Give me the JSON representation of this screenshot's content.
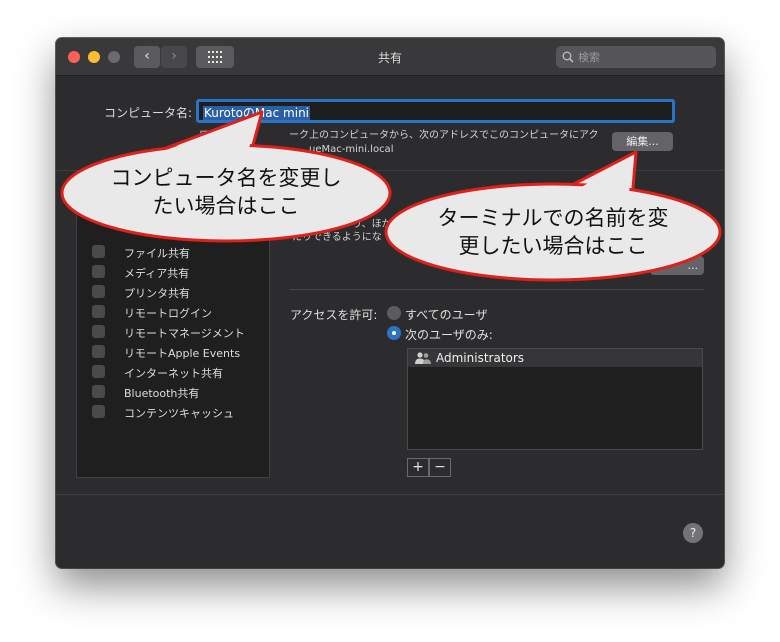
{
  "window": {
    "title": "共有",
    "search_placeholder": "検索"
  },
  "computer_name": {
    "label": "コンピュータ名:",
    "value_selected": "KurotoのMac mini",
    "edit_button": "編集...",
    "description_line1": "ローカル　　　　　ーク上のコンピュータから、次のアドレスでこのコンピュータにアク",
    "description_line2": "　　　　　　　　　　　ueMac-mini.local"
  },
  "services": {
    "items": [
      {
        "label": "ファイル共有"
      },
      {
        "label": "メディア共有"
      },
      {
        "label": "プリンタ共有"
      },
      {
        "label": "リモートログイン"
      },
      {
        "label": "リモートマネージメント"
      },
      {
        "label": "リモートApple Events"
      },
      {
        "label": "インターネット共有"
      },
      {
        "label": "Bluetooth共有"
      },
      {
        "label": "コンテンツキャッシュ"
      }
    ]
  },
  "detail": {
    "desc_line1": "　　　　　　り、ほか",
    "desc_line2": "たりできるようにな",
    "options_button": "...",
    "access_label": "アクセスを許可:",
    "radio_all": "すべてのユーザ",
    "radio_only": "次のユーザのみ:",
    "users": [
      "Administrators"
    ],
    "plus": "+",
    "minus": "−",
    "help": "?"
  },
  "callouts": {
    "left_line1": "コンピュータ名を変更し",
    "left_line2": "たい場合はここ",
    "right_line1": "ターミナルでの名前を変",
    "right_line2": "更したい場合はここ"
  },
  "colors": {
    "accent": "#2a74c8",
    "callout_fill": "#e9e9e9",
    "callout_stroke": "#e0201a"
  }
}
